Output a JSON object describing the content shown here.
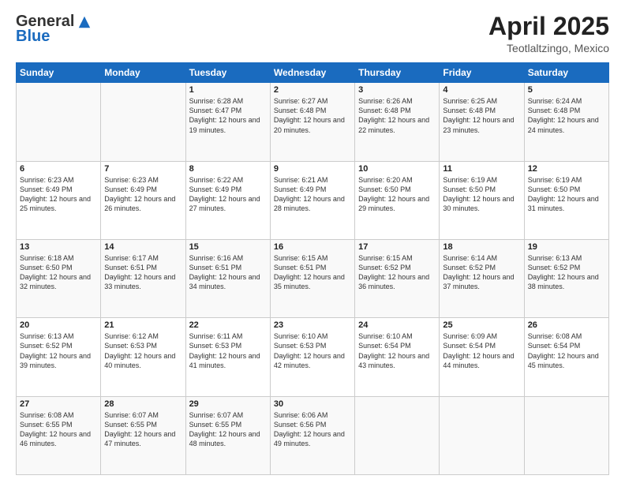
{
  "header": {
    "logo_general": "General",
    "logo_blue": "Blue",
    "month_title": "April 2025",
    "location": "Teotlaltzingo, Mexico"
  },
  "days_of_week": [
    "Sunday",
    "Monday",
    "Tuesday",
    "Wednesday",
    "Thursday",
    "Friday",
    "Saturday"
  ],
  "weeks": [
    [
      {
        "day": "",
        "info": ""
      },
      {
        "day": "",
        "info": ""
      },
      {
        "day": "1",
        "info": "Sunrise: 6:28 AM\nSunset: 6:47 PM\nDaylight: 12 hours and 19 minutes."
      },
      {
        "day": "2",
        "info": "Sunrise: 6:27 AM\nSunset: 6:48 PM\nDaylight: 12 hours and 20 minutes."
      },
      {
        "day": "3",
        "info": "Sunrise: 6:26 AM\nSunset: 6:48 PM\nDaylight: 12 hours and 22 minutes."
      },
      {
        "day": "4",
        "info": "Sunrise: 6:25 AM\nSunset: 6:48 PM\nDaylight: 12 hours and 23 minutes."
      },
      {
        "day": "5",
        "info": "Sunrise: 6:24 AM\nSunset: 6:48 PM\nDaylight: 12 hours and 24 minutes."
      }
    ],
    [
      {
        "day": "6",
        "info": "Sunrise: 6:23 AM\nSunset: 6:49 PM\nDaylight: 12 hours and 25 minutes."
      },
      {
        "day": "7",
        "info": "Sunrise: 6:23 AM\nSunset: 6:49 PM\nDaylight: 12 hours and 26 minutes."
      },
      {
        "day": "8",
        "info": "Sunrise: 6:22 AM\nSunset: 6:49 PM\nDaylight: 12 hours and 27 minutes."
      },
      {
        "day": "9",
        "info": "Sunrise: 6:21 AM\nSunset: 6:49 PM\nDaylight: 12 hours and 28 minutes."
      },
      {
        "day": "10",
        "info": "Sunrise: 6:20 AM\nSunset: 6:50 PM\nDaylight: 12 hours and 29 minutes."
      },
      {
        "day": "11",
        "info": "Sunrise: 6:19 AM\nSunset: 6:50 PM\nDaylight: 12 hours and 30 minutes."
      },
      {
        "day": "12",
        "info": "Sunrise: 6:19 AM\nSunset: 6:50 PM\nDaylight: 12 hours and 31 minutes."
      }
    ],
    [
      {
        "day": "13",
        "info": "Sunrise: 6:18 AM\nSunset: 6:50 PM\nDaylight: 12 hours and 32 minutes."
      },
      {
        "day": "14",
        "info": "Sunrise: 6:17 AM\nSunset: 6:51 PM\nDaylight: 12 hours and 33 minutes."
      },
      {
        "day": "15",
        "info": "Sunrise: 6:16 AM\nSunset: 6:51 PM\nDaylight: 12 hours and 34 minutes."
      },
      {
        "day": "16",
        "info": "Sunrise: 6:15 AM\nSunset: 6:51 PM\nDaylight: 12 hours and 35 minutes."
      },
      {
        "day": "17",
        "info": "Sunrise: 6:15 AM\nSunset: 6:52 PM\nDaylight: 12 hours and 36 minutes."
      },
      {
        "day": "18",
        "info": "Sunrise: 6:14 AM\nSunset: 6:52 PM\nDaylight: 12 hours and 37 minutes."
      },
      {
        "day": "19",
        "info": "Sunrise: 6:13 AM\nSunset: 6:52 PM\nDaylight: 12 hours and 38 minutes."
      }
    ],
    [
      {
        "day": "20",
        "info": "Sunrise: 6:13 AM\nSunset: 6:52 PM\nDaylight: 12 hours and 39 minutes."
      },
      {
        "day": "21",
        "info": "Sunrise: 6:12 AM\nSunset: 6:53 PM\nDaylight: 12 hours and 40 minutes."
      },
      {
        "day": "22",
        "info": "Sunrise: 6:11 AM\nSunset: 6:53 PM\nDaylight: 12 hours and 41 minutes."
      },
      {
        "day": "23",
        "info": "Sunrise: 6:10 AM\nSunset: 6:53 PM\nDaylight: 12 hours and 42 minutes."
      },
      {
        "day": "24",
        "info": "Sunrise: 6:10 AM\nSunset: 6:54 PM\nDaylight: 12 hours and 43 minutes."
      },
      {
        "day": "25",
        "info": "Sunrise: 6:09 AM\nSunset: 6:54 PM\nDaylight: 12 hours and 44 minutes."
      },
      {
        "day": "26",
        "info": "Sunrise: 6:08 AM\nSunset: 6:54 PM\nDaylight: 12 hours and 45 minutes."
      }
    ],
    [
      {
        "day": "27",
        "info": "Sunrise: 6:08 AM\nSunset: 6:55 PM\nDaylight: 12 hours and 46 minutes."
      },
      {
        "day": "28",
        "info": "Sunrise: 6:07 AM\nSunset: 6:55 PM\nDaylight: 12 hours and 47 minutes."
      },
      {
        "day": "29",
        "info": "Sunrise: 6:07 AM\nSunset: 6:55 PM\nDaylight: 12 hours and 48 minutes."
      },
      {
        "day": "30",
        "info": "Sunrise: 6:06 AM\nSunset: 6:56 PM\nDaylight: 12 hours and 49 minutes."
      },
      {
        "day": "",
        "info": ""
      },
      {
        "day": "",
        "info": ""
      },
      {
        "day": "",
        "info": ""
      }
    ]
  ]
}
